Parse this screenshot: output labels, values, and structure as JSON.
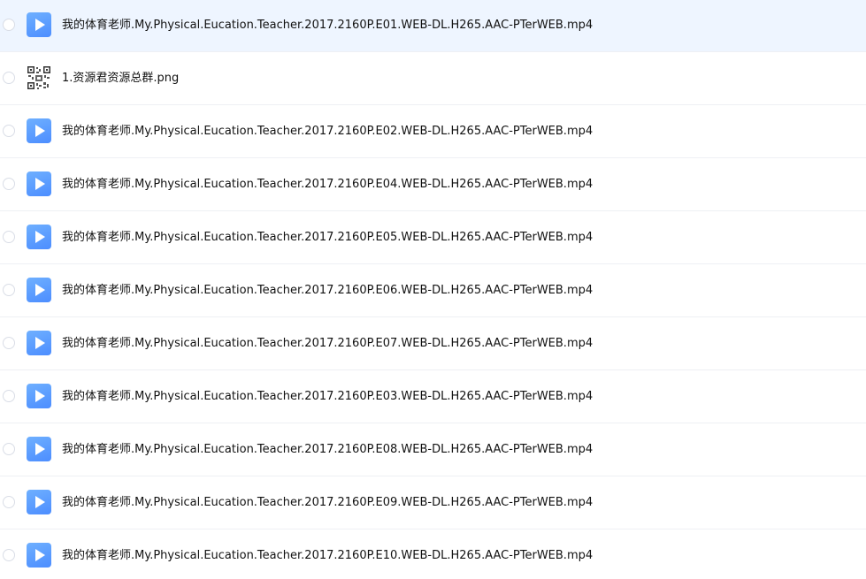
{
  "files": [
    {
      "name": "我的体育老师.My.Physical.Eucation.Teacher.2017.2160P.E01.WEB-DL.H265.AAC-PTerWEB.mp4",
      "icon": "video-file-icon",
      "selected": true
    },
    {
      "name": "1.资源君资源总群.png",
      "icon": "qr-image-file-icon",
      "selected": false
    },
    {
      "name": "我的体育老师.My.Physical.Eucation.Teacher.2017.2160P.E02.WEB-DL.H265.AAC-PTerWEB.mp4",
      "icon": "video-file-icon",
      "selected": false
    },
    {
      "name": "我的体育老师.My.Physical.Eucation.Teacher.2017.2160P.E04.WEB-DL.H265.AAC-PTerWEB.mp4",
      "icon": "video-file-icon",
      "selected": false
    },
    {
      "name": "我的体育老师.My.Physical.Eucation.Teacher.2017.2160P.E05.WEB-DL.H265.AAC-PTerWEB.mp4",
      "icon": "video-file-icon",
      "selected": false
    },
    {
      "name": "我的体育老师.My.Physical.Eucation.Teacher.2017.2160P.E06.WEB-DL.H265.AAC-PTerWEB.mp4",
      "icon": "video-file-icon",
      "selected": false
    },
    {
      "name": "我的体育老师.My.Physical.Eucation.Teacher.2017.2160P.E07.WEB-DL.H265.AAC-PTerWEB.mp4",
      "icon": "video-file-icon",
      "selected": false
    },
    {
      "name": "我的体育老师.My.Physical.Eucation.Teacher.2017.2160P.E03.WEB-DL.H265.AAC-PTerWEB.mp4",
      "icon": "video-file-icon",
      "selected": false
    },
    {
      "name": "我的体育老师.My.Physical.Eucation.Teacher.2017.2160P.E08.WEB-DL.H265.AAC-PTerWEB.mp4",
      "icon": "video-file-icon",
      "selected": false
    },
    {
      "name": "我的体育老师.My.Physical.Eucation.Teacher.2017.2160P.E09.WEB-DL.H265.AAC-PTerWEB.mp4",
      "icon": "video-file-icon",
      "selected": false
    },
    {
      "name": "我的体育老师.My.Physical.Eucation.Teacher.2017.2160P.E10.WEB-DL.H265.AAC-PTerWEB.mp4",
      "icon": "video-file-icon",
      "selected": false
    }
  ]
}
